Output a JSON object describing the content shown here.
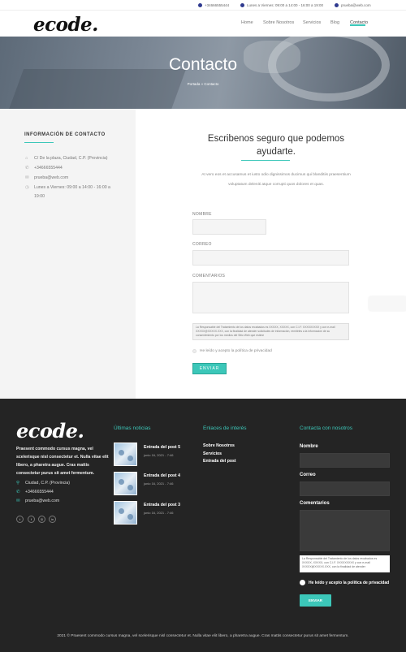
{
  "topbar": {
    "phone": "+34666555444",
    "hours": "Lunes a Viernes: 09:00 a 14:00 - 16:00 a 19:00",
    "email": "prueba@web.com"
  },
  "header": {
    "logo": "ecode.",
    "nav": [
      "Home",
      "Sobre Nosotros",
      "Servicios",
      "Blog",
      "Contacto"
    ]
  },
  "hero": {
    "title": "Contacto",
    "breadcrumb": "Portada » Contacto"
  },
  "sidebar": {
    "heading": "INFORMACIÓN DE CONTACTO",
    "address": "C/ De la plaza, Ciudad, C.P. (Provincia)",
    "phone": "+34666555444",
    "email": "prueba@web.com",
    "hours_line1": "Lunes a Viernes: 09:00 a 14:00 - 16:00 a",
    "hours_line2": "19:00"
  },
  "form": {
    "heading": "Escribenos seguro que podemos ayudarte.",
    "intro": "At vero eos et accusamus et iusto odio dignissimos ducimus qui blanditiis praesentium voluptatum deleniti atque corrupti quos dolores et quas.",
    "name_label": "NOMBRE",
    "email_label": "CORREO",
    "comments_label": "COMENTARIOS",
    "privacy_text": "La Responsable del Tratamiento de los datos recabados es XXXXX, XXXXX, con C.I.F. XXXXXXXXX y con e-mail XXXXX@XXXXX.XXX, con la finalidad de atender solicitudes de información, remitirles a la información de su consentimiento por los medios del Sitio Web que estime",
    "consent_label": "He leído y acepto la política de privacidad",
    "submit_label": "ENVIAR"
  },
  "footer": {
    "logo": "ecode.",
    "description": "Praesent commodo cursus magna, vel scelerisque nisl consectetur et. Nulla vitae elit libero, a pharetra augue. Cras mattis consectetur purus sit amet fermentum.",
    "location": "Ciudad, C.P. (Provincia)",
    "phone": "+34666555444",
    "email": "prueba@web.com",
    "social": [
      "twitter-icon",
      "facebook-icon",
      "instagram-icon",
      "linkedin-icon"
    ],
    "posts_title": "Últimas noticias",
    "posts": [
      {
        "title": "Entrada del post 5",
        "date": "junio 16, 2021 - 7:46"
      },
      {
        "title": "Entrada del post 4",
        "date": "junio 16, 2021 - 7:46"
      },
      {
        "title": "Entrada del post 3",
        "date": "junio 16, 2021 - 7:46"
      }
    ],
    "links_title": "Enlaces de interés",
    "links": [
      "Sobre Nosotros",
      "Servicios",
      "Entrada del post"
    ],
    "contact_title": "Contacta con nosotros",
    "contact_name_label": "Nombre",
    "contact_email_label": "Correo",
    "contact_comments_label": "Comentarios",
    "contact_privacy_text": "La Responsable del Tratamiento de los datos recabados es XXXXX, XXXXX, con C.I.F. XXXXXXXXX y con e-mail XXXXX@XXXXX.XXX, con la finalidad de atender",
    "contact_consent_label": "He leído y acepto la política de privacidad",
    "contact_submit_label": "ENVIAR",
    "copyright": "2021 © Praesent commodo cursus magna, vel scelerisque nisl consectetur et. Nulla vitae elit libero, a pharetra augue. Cras mattis consectetur purus sit amet fermentum."
  },
  "colors": {
    "accent": "#3cc7b9",
    "footer_bg": "#242424",
    "sidebar_bg": "#f4f4f4"
  }
}
